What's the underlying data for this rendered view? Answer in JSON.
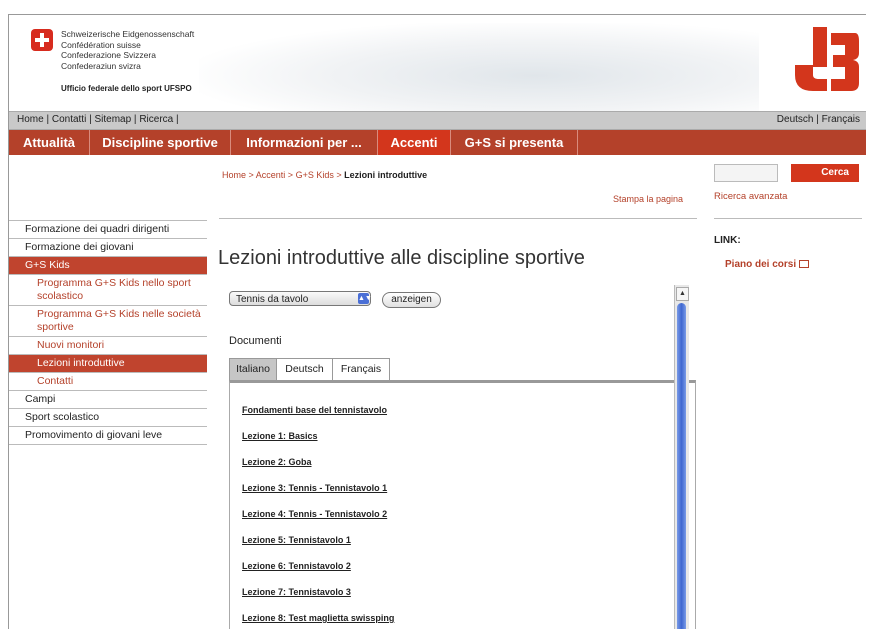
{
  "header": {
    "confederation_lines": [
      "Schweizerische Eidgenossenschaft",
      "Confédération suisse",
      "Confederazione Svizzera",
      "Confederaziun svizra"
    ],
    "office": "Ufficio federale dello sport UFSPO"
  },
  "utility_nav": {
    "home": "Home",
    "contact": "Contatti",
    "sitemap": "Sitemap",
    "search": "Ricerca",
    "lang_de": "Deutsch",
    "lang_fr": "Français"
  },
  "main_nav": [
    {
      "label": "Attualità"
    },
    {
      "label": "Discipline sportive"
    },
    {
      "label": "Informazioni per ..."
    },
    {
      "label": "Accenti"
    },
    {
      "label": "G+S si presenta"
    }
  ],
  "breadcrumb": {
    "home": "Home",
    "accenti": "Accenti",
    "kids": "G+S Kids",
    "current": "Lezioni introduttive"
  },
  "print_label": "Stampa la pagina",
  "search": {
    "button": "Cerca",
    "advanced": "Ricerca avanzata"
  },
  "links": {
    "title": "LINK:",
    "item": "Piano dei corsi"
  },
  "sidebar": [
    {
      "label": "Formazione dei quadri dirigenti",
      "level": 1
    },
    {
      "label": "Formazione dei giovani",
      "level": 1
    },
    {
      "label": "G+S Kids",
      "level": 1,
      "active": true
    },
    {
      "label": "Programma G+S Kids nello sport scolastico",
      "level": 2
    },
    {
      "label": "Programma G+S Kids nelle società sportive",
      "level": 2
    },
    {
      "label": "Nuovi monitori",
      "level": 2
    },
    {
      "label": "Lezioni introduttive",
      "level": 2,
      "active": true
    },
    {
      "label": "Contatti",
      "level": 2
    },
    {
      "label": "Campi",
      "level": 1
    },
    {
      "label": "Sport scolastico",
      "level": 1
    },
    {
      "label": "Promovimento di giovani leve",
      "level": 1
    }
  ],
  "content": {
    "title": "Lezioni introduttive alle discipline sportive",
    "select_value": "Tennis da tavolo",
    "go_button": "anzeigen",
    "documents_label": "Documenti",
    "tabs": [
      "Italiano",
      "Deutsch",
      "Français"
    ],
    "documents": [
      "Fondamenti base del tennistavolo",
      "Lezione 1: Basics",
      "Lezione 2: Goba",
      "Lezione 3: Tennis - Tennistavolo 1",
      "Lezione 4: Tennis - Tennistavolo 2",
      "Lezione 5: Tennistavolo 1",
      "Lezione 6: Tennistavolo 2",
      "Lezione 7: Tennistavolo 3",
      "Lezione 8: Test maglietta swissping"
    ]
  },
  "colors": {
    "brand": "#b4412a",
    "active": "#d3361c"
  }
}
